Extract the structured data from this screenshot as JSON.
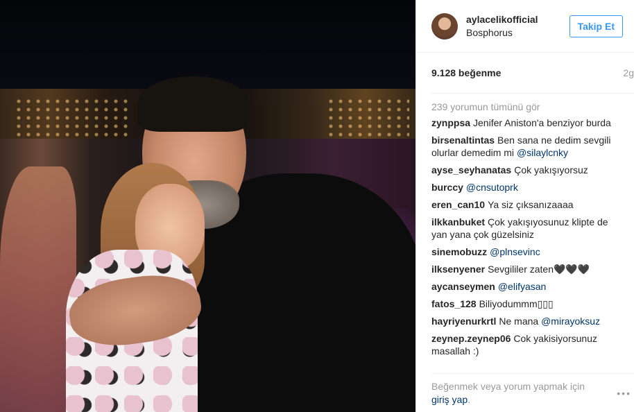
{
  "post": {
    "username": "aylacelikofficial",
    "location": "Bosphorus",
    "follow_label": "Takip Et",
    "likes": "9.128 beğenme",
    "time": "2g",
    "view_all": "239 yorumun tümünü gör"
  },
  "comments": [
    {
      "user": "zynppsa",
      "text": "Jenifer Aniston'a benziyor burda",
      "mention": ""
    },
    {
      "user": "birsenaltintas",
      "text": "Ben sana ne dedim sevgili olurlar demedim mi",
      "mention": "@silaylcnky"
    },
    {
      "user": "ayse_seyhanatas",
      "text": "Çok yakışıyorsuz",
      "mention": ""
    },
    {
      "user": "burccy",
      "text": "",
      "mention": "@cnsutoprk"
    },
    {
      "user": "eren_can10",
      "text": "Ya siz çıksanızaaaa",
      "mention": ""
    },
    {
      "user": "ilkkanbuket",
      "text": "Çok yakışıyosunuz klipte de yan yana çok güzelsiniz",
      "mention": ""
    },
    {
      "user": "sinemobuzz",
      "text": "",
      "mention": "@plnsevinc"
    },
    {
      "user": "ilksenyener",
      "text": "Sevgililer zaten🖤🖤🖤",
      "mention": ""
    },
    {
      "user": "aycanseymen",
      "text": "",
      "mention": "@elifyasan"
    },
    {
      "user": "fatos_128",
      "text": "Biliyodummm▯▯▯",
      "mention": ""
    },
    {
      "user": "hayriyenurkrtl",
      "text": "Ne mana",
      "mention": "@mirayoksuz"
    },
    {
      "user": "zeynep.zeynep06",
      "text": "Cok yakisiyorsunuz masallah :)",
      "mention": ""
    }
  ],
  "footer": {
    "login_prefix": "Beğenmek veya yorum yapmak için",
    "login_link": "giriş yap",
    "login_suffix": ".",
    "more_icon": "•••"
  }
}
